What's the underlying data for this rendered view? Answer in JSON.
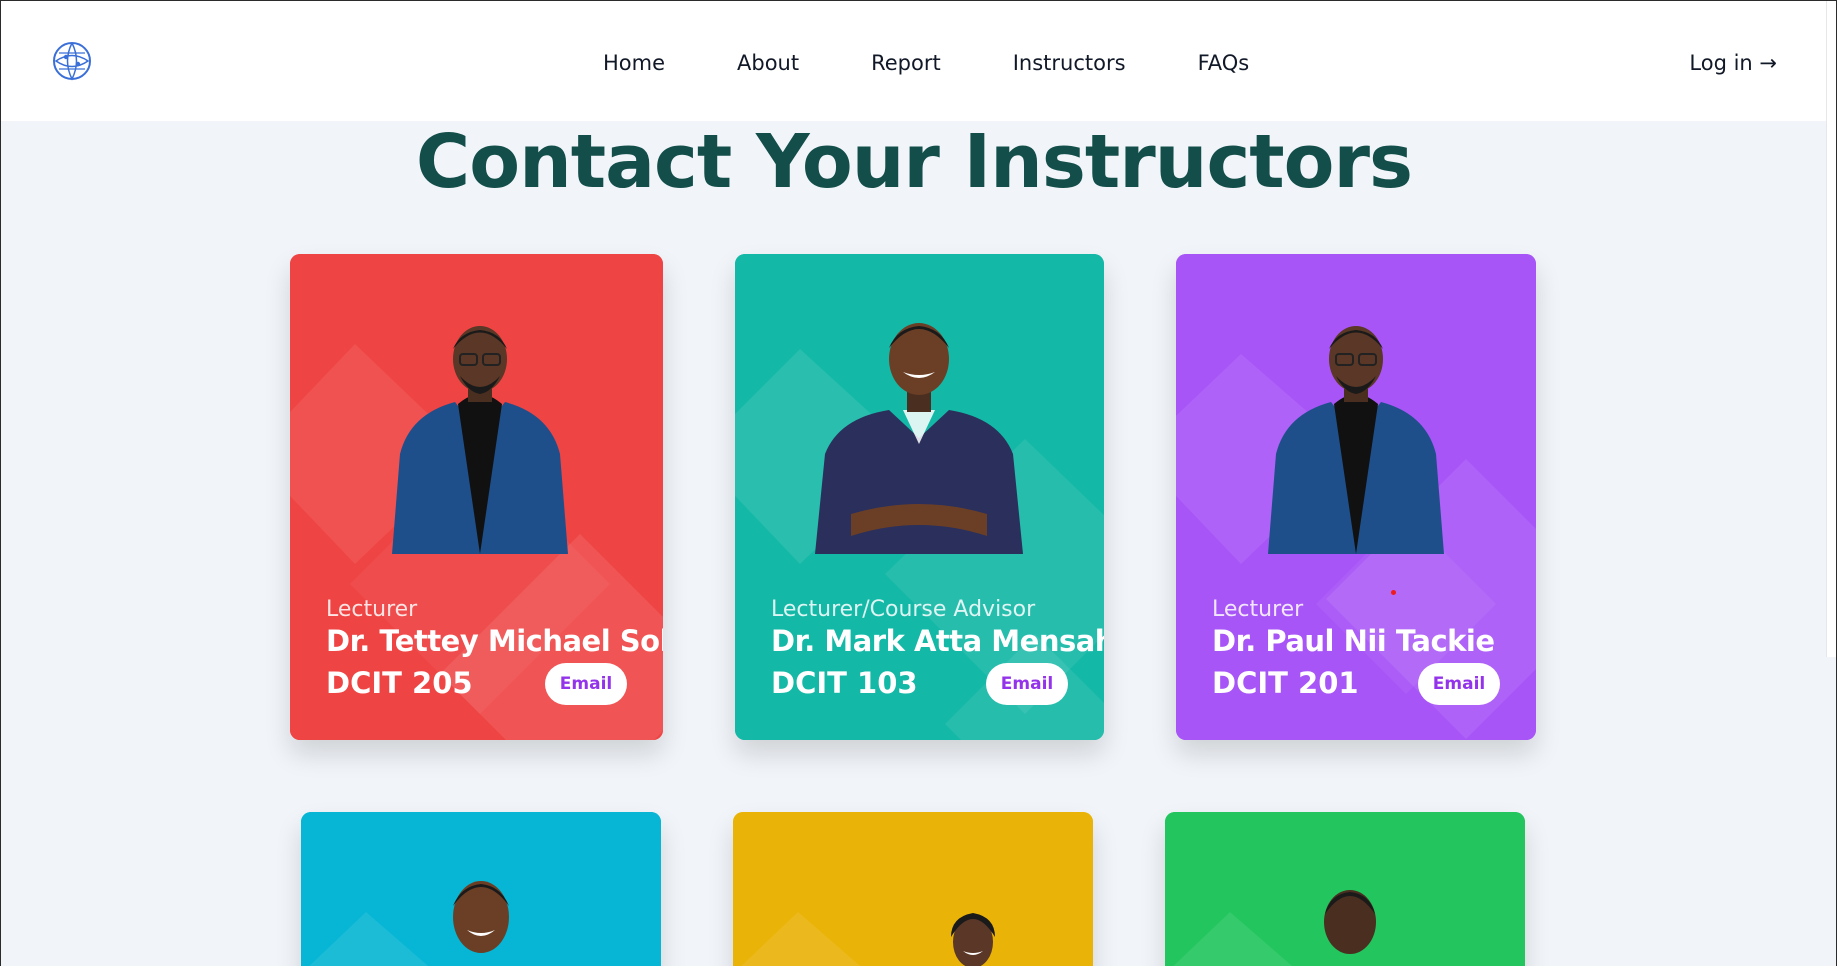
{
  "nav": {
    "logo_icon": "globe-logo-icon",
    "links": [
      "Home",
      "About",
      "Report",
      "Instructors",
      "FAQs"
    ],
    "login": "Log in →"
  },
  "page": {
    "heading": "Contact Your Instructors"
  },
  "cards": [
    {
      "role": "Lecturer",
      "name": "Dr. Tettey Michael Soli",
      "course": "DCIT 205",
      "email_label": "Email",
      "color": "#ef4444"
    },
    {
      "role": "Lecturer/Course Advisor",
      "name": "Dr. Mark Atta Mensah",
      "course": "DCIT 103",
      "email_label": "Email",
      "color": "#14b8a6"
    },
    {
      "role": "Lecturer",
      "name": "Dr. Paul Nii Tackie",
      "course": "DCIT 201",
      "email_label": "Email",
      "color": "#a855f7"
    },
    {
      "color": "#06b6d4"
    },
    {
      "color": "#eab308"
    },
    {
      "color": "#22c55e"
    }
  ],
  "colors": {
    "heading": "#134e4a",
    "email_text": "#9333ea",
    "background": "#f1f5f9"
  }
}
